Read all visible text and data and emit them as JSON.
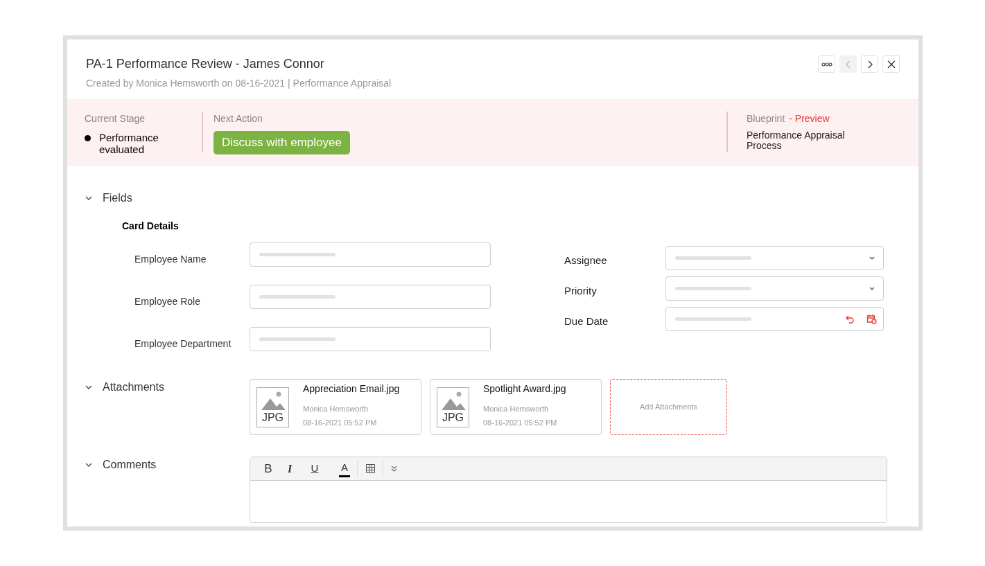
{
  "header": {
    "title": "PA-1 Performance Review - James Connor",
    "subtitle": "Created by Monica Hemsworth on 08-16-2021 | Performance Appraisal",
    "nav": [
      {
        "kind": "more",
        "disabled": false
      },
      {
        "kind": "prev",
        "disabled": true
      },
      {
        "kind": "next",
        "disabled": false
      },
      {
        "kind": "close",
        "disabled": false
      }
    ]
  },
  "stage_bar": {
    "current_stage_label": "Current Stage",
    "current_stage": "Performance evaluated",
    "next_action_label": "Next Action",
    "next_action": "Discuss with employee",
    "blueprint_label": "Blueprint",
    "blueprint_tag": "- Preview",
    "blueprint": "Performance Appraisal Process"
  },
  "fields_section": {
    "title": "Fields",
    "expanded": true,
    "subtitle": "Card Details",
    "left_fields": [
      {
        "label": "Employee Name",
        "kind": "text"
      },
      {
        "label": "Employee Role",
        "kind": "text"
      },
      {
        "label": "Employee Department",
        "kind": "text"
      }
    ],
    "right_fields": [
      {
        "label": "Assignee",
        "kind": "select"
      },
      {
        "label": "Priority",
        "kind": "select"
      },
      {
        "label": "Due Date",
        "kind": "date"
      }
    ]
  },
  "attachments_section": {
    "title": "Attachments",
    "expanded": true,
    "files": [
      {
        "name": "Appreciation Email.jpg",
        "type": "JPG",
        "author": "Monica Hemsworth",
        "time": "08-16-2021 05:52 PM"
      },
      {
        "name": "Spotlight Award.jpg",
        "type": "JPG",
        "author": "Monica Hemsworth",
        "time": "08-16-2021 05:52 PM"
      }
    ],
    "add_label": "Add Attachments"
  },
  "comments_section": {
    "title": "Comments",
    "expanded": true,
    "toolbar": [
      {
        "kind": "bold",
        "label": "B"
      },
      {
        "kind": "italic",
        "label": "I"
      },
      {
        "kind": "underline",
        "label": "U"
      },
      {
        "kind": "color",
        "label": "A"
      },
      {
        "kind": "table"
      },
      {
        "kind": "more"
      }
    ]
  }
}
